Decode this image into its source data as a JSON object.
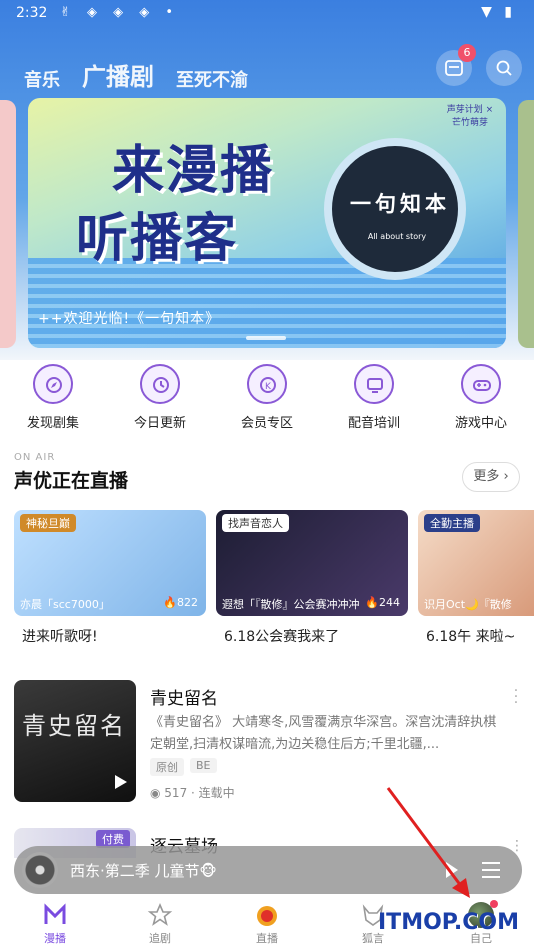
{
  "statusbar": {
    "time": "2:32"
  },
  "topnav": {
    "tabs": [
      {
        "label": "音乐"
      },
      {
        "label": "广播剧"
      },
      {
        "label": "至死不渝"
      }
    ],
    "mail_badge": "6"
  },
  "banner": {
    "title_line1": "来漫播",
    "title_line2": "听播客",
    "disc_title": "一句知本",
    "disc_subtitle": "All about story",
    "badge": "声芽计划 × 芒竹萌芽",
    "caption": "++欢迎光临!《一句知本》"
  },
  "quick_entries": [
    {
      "label": "发现剧集",
      "icon": "discover-icon"
    },
    {
      "label": "今日更新",
      "icon": "calendar-update-icon"
    },
    {
      "label": "会员专区",
      "icon": "vip-icon"
    },
    {
      "label": "配音培训",
      "icon": "training-icon"
    },
    {
      "label": "游戏中心",
      "icon": "gamepad-icon"
    }
  ],
  "live_section": {
    "eyebrow": "ON AIR",
    "title": "声优正在直播",
    "more_label": "更多",
    "cards": [
      {
        "tag": "神秘旦巅",
        "name": "亦晨「scc7000」",
        "heat": "822",
        "caption": "进来听歌呀!",
        "color": "#9fc7ef"
      },
      {
        "tag": "找声音恋人",
        "name": "遐想「『散修』公会赛冲冲冲",
        "heat": "244",
        "caption": "6.18公会赛我来了",
        "color": "#2a2a4a"
      },
      {
        "tag": "全勤主播",
        "name": "识月Oct🌙『散修",
        "heat": "",
        "caption": "6.18午 来啦~",
        "color": "#f0d4c2"
      }
    ]
  },
  "dramas": [
    {
      "title": "青史留名",
      "cover_text": "青史留名",
      "description": "《青史留名》 大靖寒冬,风雪覆满京华深宫。深宫沈清辞执棋定朝堂,扫清权谋暗流,为边关稳住后方;千里北疆,...",
      "tags": [
        "原创",
        "BE"
      ],
      "stats": "517 · 连载中"
    },
    {
      "title": "逐云墓场",
      "badge": "付费"
    }
  ],
  "player": {
    "title": "西东·第二季 儿童节🐵"
  },
  "bottom_nav": [
    {
      "label": "漫播",
      "icon": "manbo-icon",
      "active": true
    },
    {
      "label": "追剧",
      "icon": "star-icon",
      "active": false
    },
    {
      "label": "直播",
      "icon": "live-icon",
      "active": false
    },
    {
      "label": "狐言",
      "icon": "fox-icon",
      "active": false
    },
    {
      "label": "自己",
      "icon": "avatar",
      "active": false
    }
  ],
  "watermark": "ITMOP.COM",
  "colors": {
    "accent": "#7a4be0",
    "header_top": "#3b7fe0",
    "badge_red": "#f0506a",
    "arrow": "#e02020"
  }
}
